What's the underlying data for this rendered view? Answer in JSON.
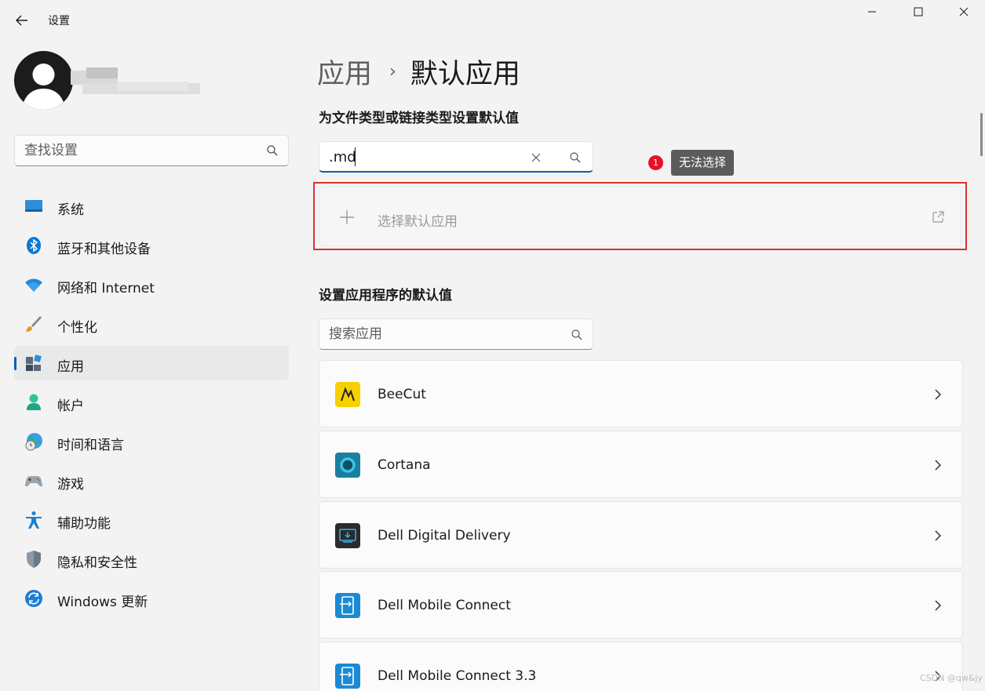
{
  "titlebar": {
    "back_label": "←",
    "title": "设置"
  },
  "search": {
    "placeholder": "查找设置"
  },
  "nav": {
    "items": [
      {
        "label": "系统",
        "icon": "monitor-icon"
      },
      {
        "label": "蓝牙和其他设备",
        "icon": "bluetooth-icon"
      },
      {
        "label": "网络和 Internet",
        "icon": "wifi-icon"
      },
      {
        "label": "个性化",
        "icon": "brush-icon"
      },
      {
        "label": "应用",
        "icon": "apps-icon",
        "active": true
      },
      {
        "label": "帐户",
        "icon": "account-icon"
      },
      {
        "label": "时间和语言",
        "icon": "globe-clock-icon"
      },
      {
        "label": "游戏",
        "icon": "gamepad-icon"
      },
      {
        "label": "辅助功能",
        "icon": "accessibility-icon"
      },
      {
        "label": "隐私和安全性",
        "icon": "shield-icon"
      },
      {
        "label": "Windows 更新",
        "icon": "update-icon"
      }
    ]
  },
  "main": {
    "breadcrumb_parent": "应用",
    "breadcrumb_sep": "›",
    "breadcrumb_current": "默认应用",
    "filetype_section_title": "为文件类型或链接类型设置默认值",
    "filetype_value": ".md",
    "badge_count": "1",
    "tooltip": "无法选择",
    "choose_default_label": "选择默认应用",
    "apps_section_title": "设置应用程序的默认值",
    "app_search_placeholder": "搜索应用",
    "apps": [
      {
        "name": "BeeCut",
        "icon": "beecut-icon"
      },
      {
        "name": "Cortana",
        "icon": "cortana-icon"
      },
      {
        "name": "Dell Digital Delivery",
        "icon": "dell-digital-delivery-icon"
      },
      {
        "name": "Dell Mobile Connect",
        "icon": "dell-mobile-connect-icon"
      },
      {
        "name": "Dell Mobile Connect 3.3",
        "icon": "dell-mobile-connect-icon"
      }
    ]
  },
  "watermark": "CSDN @qw&jy",
  "colors": {
    "accent": "#005fb8",
    "highlight_frame": "#e03030",
    "badge": "#e81123"
  }
}
